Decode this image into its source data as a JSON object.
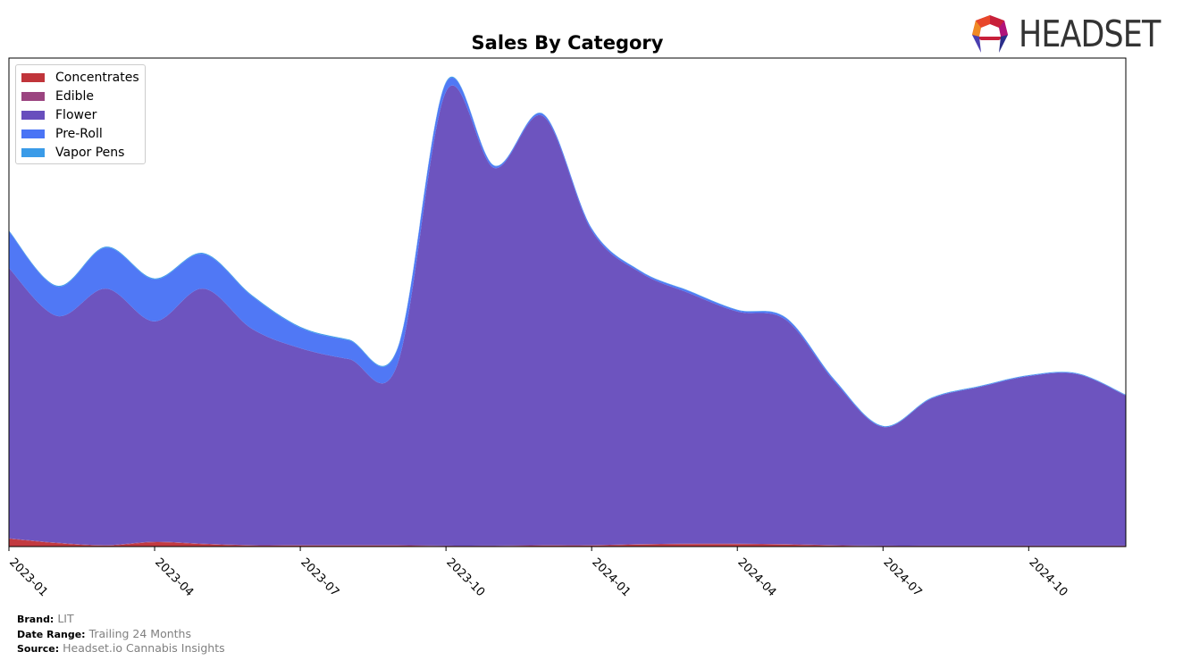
{
  "logo_text": "HEADSET",
  "chart_data": {
    "type": "area",
    "stacked": true,
    "title": "Sales By Category",
    "xlabel": "",
    "ylabel": "",
    "y_axis_labels_shown": false,
    "ylim": [
      0,
      100
    ],
    "legend_position": "top-left",
    "x": [
      "2023-01",
      "2023-02",
      "2023-03",
      "2023-04",
      "2023-05",
      "2023-06",
      "2023-07",
      "2023-08",
      "2023-09",
      "2023-10",
      "2023-11",
      "2023-12",
      "2024-01",
      "2024-02",
      "2024-03",
      "2024-04",
      "2024-05",
      "2024-06",
      "2024-07",
      "2024-08",
      "2024-09",
      "2024-10",
      "2024-11",
      "2024-12"
    ],
    "x_tick_labels": [
      "2023-01",
      "2023-04",
      "2023-07",
      "2023-10",
      "2024-01",
      "2024-04",
      "2024-07",
      "2024-10"
    ],
    "series": [
      {
        "name": "Concentrates",
        "color": "#c0343a",
        "values": [
          1.6,
          0.7,
          0.2,
          0.9,
          0.5,
          0.2,
          0.2,
          0.2,
          0.2,
          0.1,
          0.1,
          0.2,
          0.2,
          0.4,
          0.5,
          0.5,
          0.4,
          0.2,
          0.1,
          0.1,
          0.1,
          0.1,
          0.1,
          0.1
        ]
      },
      {
        "name": "Edible",
        "color": "#9b4480",
        "values": [
          0.1,
          0.1,
          0.1,
          0.1,
          0.1,
          0.1,
          0.1,
          0.1,
          0.1,
          0.1,
          0.1,
          0.1,
          0.1,
          0.1,
          0.1,
          0.1,
          0.1,
          0.1,
          0.1,
          0.1,
          0.1,
          0.1,
          0.1,
          0.1
        ]
      },
      {
        "name": "Flower",
        "color": "#684ebd",
        "values": [
          55.3,
          46.4,
          52.5,
          45.1,
          52.2,
          44.3,
          40.3,
          38.1,
          37.0,
          92.9,
          77.3,
          87.8,
          64.4,
          55.6,
          51.3,
          47.5,
          45.9,
          33.5,
          24.3,
          30.1,
          32.5,
          34.7,
          35.1,
          30.7
        ]
      },
      {
        "name": "Pre-Roll",
        "color": "#4a74f5",
        "values": [
          7.5,
          6.0,
          8.4,
          8.6,
          7.1,
          6.7,
          4.2,
          3.8,
          3.1,
          1.8,
          0.4,
          0.4,
          0.4,
          0.3,
          0.4,
          0.3,
          0.4,
          0.3,
          0.1,
          0.1,
          0.1,
          0.1,
          0.1,
          0.1
        ]
      },
      {
        "name": "Vapor Pens",
        "color": "#3a9be8",
        "values": [
          0.2,
          0.2,
          0.2,
          0.2,
          0.2,
          0.2,
          0.2,
          0.2,
          0.2,
          0.2,
          0.1,
          0.1,
          0.1,
          0.1,
          0.1,
          0.1,
          0.1,
          0.1,
          0.1,
          0.1,
          0.1,
          0.1,
          0.1,
          0.1
        ]
      }
    ]
  },
  "footer": {
    "brand_label": "Brand:",
    "brand_value": "LIT",
    "range_label": "Date Range:",
    "range_value": "Trailing 24 Months",
    "source_label": "Source:",
    "source_value": "Headset.io Cannabis Insights"
  }
}
